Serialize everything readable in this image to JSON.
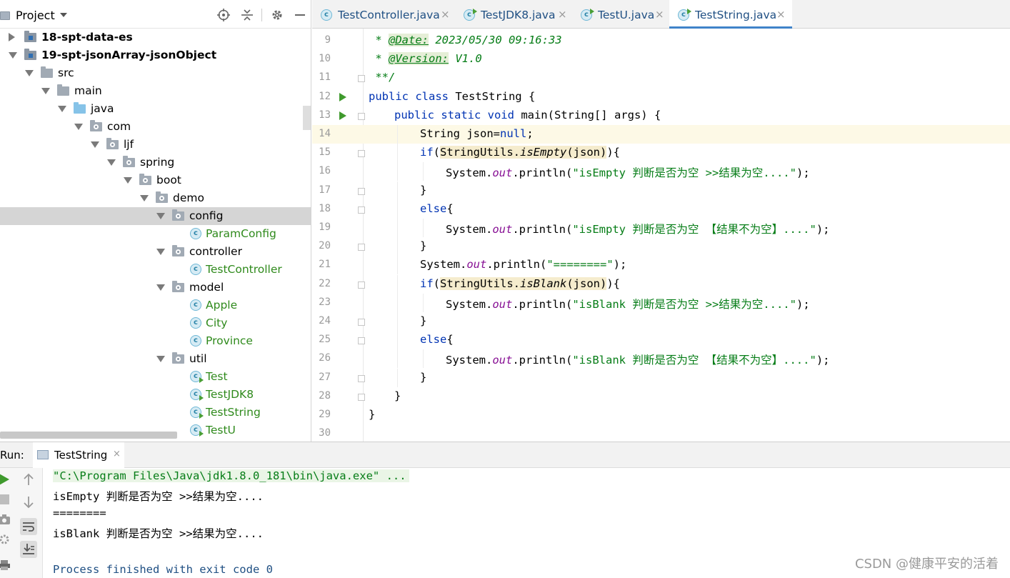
{
  "project": {
    "title": "Project",
    "toolbar_icons": [
      "locate-icon",
      "collapse-icon",
      "gear-icon",
      "minimize-icon"
    ],
    "tree": [
      {
        "label": "18-spt-data-es",
        "kind": "module",
        "expanded": false,
        "bold": true
      },
      {
        "label": "19-spt-jsonArray-jsonObject",
        "kind": "module",
        "expanded": true,
        "bold": true
      },
      {
        "label": "src",
        "kind": "folder",
        "expanded": true
      },
      {
        "label": "main",
        "kind": "folder",
        "expanded": true
      },
      {
        "label": "java",
        "kind": "source-folder",
        "expanded": true
      },
      {
        "label": "com",
        "kind": "package",
        "expanded": true
      },
      {
        "label": "ljf",
        "kind": "package",
        "expanded": true
      },
      {
        "label": "spring",
        "kind": "package",
        "expanded": true
      },
      {
        "label": "boot",
        "kind": "package",
        "expanded": true
      },
      {
        "label": "demo",
        "kind": "package",
        "expanded": true
      },
      {
        "label": "config",
        "kind": "package",
        "expanded": true,
        "selected": true
      },
      {
        "label": "ParamConfig",
        "kind": "class"
      },
      {
        "label": "controller",
        "kind": "package",
        "expanded": true
      },
      {
        "label": "TestController",
        "kind": "class"
      },
      {
        "label": "model",
        "kind": "package",
        "expanded": true
      },
      {
        "label": "Apple",
        "kind": "class"
      },
      {
        "label": "City",
        "kind": "class"
      },
      {
        "label": "Province",
        "kind": "class"
      },
      {
        "label": "util",
        "kind": "package",
        "expanded": true
      },
      {
        "label": "Test",
        "kind": "runnable-class"
      },
      {
        "label": "TestJDK8",
        "kind": "runnable-class"
      },
      {
        "label": "TestString",
        "kind": "runnable-class"
      },
      {
        "label": "TestU",
        "kind": "runnable-class"
      }
    ]
  },
  "tabs": [
    {
      "label": "TestController.java",
      "icon": "class-icon",
      "active": false
    },
    {
      "label": "TestJDK8.java",
      "icon": "runnable-class-icon",
      "active": false
    },
    {
      "label": "TestU.java",
      "icon": "runnable-class-icon",
      "active": false
    },
    {
      "label": "TestString.java",
      "icon": "runnable-class-icon",
      "active": true
    }
  ],
  "tab_close_glyph": "×",
  "editor": {
    "current_line": 14,
    "lines": [
      {
        "n": "9"
      },
      {
        "n": "10"
      },
      {
        "n": "11"
      },
      {
        "n": "12"
      },
      {
        "n": "13"
      },
      {
        "n": "14"
      },
      {
        "n": "15"
      },
      {
        "n": "16"
      },
      {
        "n": "17"
      },
      {
        "n": "18"
      },
      {
        "n": "19"
      },
      {
        "n": "20"
      },
      {
        "n": "21"
      },
      {
        "n": "22"
      },
      {
        "n": "23"
      },
      {
        "n": "24"
      },
      {
        "n": "25"
      },
      {
        "n": "26"
      },
      {
        "n": "27"
      },
      {
        "n": "28"
      },
      {
        "n": "29"
      },
      {
        "n": "30"
      }
    ],
    "code": {
      "l9_star": " * ",
      "l9_tag": "@Date:",
      "l9_val": " 2023/05/30 09:16:33",
      "l10_star": " * ",
      "l10_tag": "@Version:",
      "l10_val": " V1.0",
      "l11": " **/",
      "l12_kw": "public class",
      "l12_rest": " TestString {",
      "l13_kw": "public static void",
      "l13_rest": " main(String[] args) {",
      "l14_a": "String json=",
      "l14_kw": "null",
      "l14_b": ";",
      "l15_kw": "if",
      "l15_a": "(",
      "l15_hl_cls": "StringUtils.",
      "l15_hl_m": "isEmpty",
      "l15_hl_arg": "(json)",
      "l15_b": "){",
      "l16_a": "System.",
      "l16_out": "out",
      "l16_b": ".println(",
      "l16_str": "\"isEmpty 判断是否为空 >>结果为空....\"",
      "l16_c": ");",
      "l17": "}",
      "l18_kw": "else",
      "l18_b": "{",
      "l19_a": "System.",
      "l19_out": "out",
      "l19_b": ".println(",
      "l19_str": "\"isEmpty 判断是否为空 【结果不为空】....\"",
      "l19_c": ");",
      "l20": "}",
      "l21_a": "System.",
      "l21_out": "out",
      "l21_b": ".println(",
      "l21_str": "\"========\"",
      "l21_c": ");",
      "l22_kw": "if",
      "l22_a": "(",
      "l22_hl_cls": "StringUtils.",
      "l22_hl_m": "isBlank",
      "l22_hl_arg": "(json)",
      "l22_b": "){",
      "l23_a": "System.",
      "l23_out": "out",
      "l23_b": ".println(",
      "l23_str": "\"isBlank 判断是否为空 >>结果为空....\"",
      "l23_c": ");",
      "l24": "}",
      "l25_kw": "else",
      "l25_b": "{",
      "l26_a": "System.",
      "l26_out": "out",
      "l26_b": ".println(",
      "l26_str": "\"isBlank 判断是否为空 【结果不为空】....\"",
      "l26_c": ");",
      "l27": "}",
      "l28": "}",
      "l29": "}"
    }
  },
  "run": {
    "label": "Run:",
    "tab_label": "TestString",
    "tab_close": "×",
    "toolbar": [
      "run-icon",
      "stop-icon",
      "camera-icon",
      "settings-icon",
      "print-icon",
      "up-arrow-icon",
      "down-arrow-icon",
      "soft-wrap-icon",
      "scroll-to-end-icon"
    ],
    "console": [
      "\"C:\\Program Files\\Java\\jdk1.8.0_181\\bin\\java.exe\" ...",
      "isEmpty 判断是否为空 >>结果为空....",
      "========",
      "isBlank 判断是否为空 >>结果为空....",
      "",
      "Process finished with exit code 0"
    ]
  },
  "watermark": "CSDN @健康平安的活着",
  "colors": {
    "keyword": "#0033b3",
    "string": "#067d17",
    "static_field": "#871094",
    "tab_active_underline": "#4083c9",
    "tree_selection": "#d5d5d5",
    "current_line": "#fdf9e6"
  }
}
